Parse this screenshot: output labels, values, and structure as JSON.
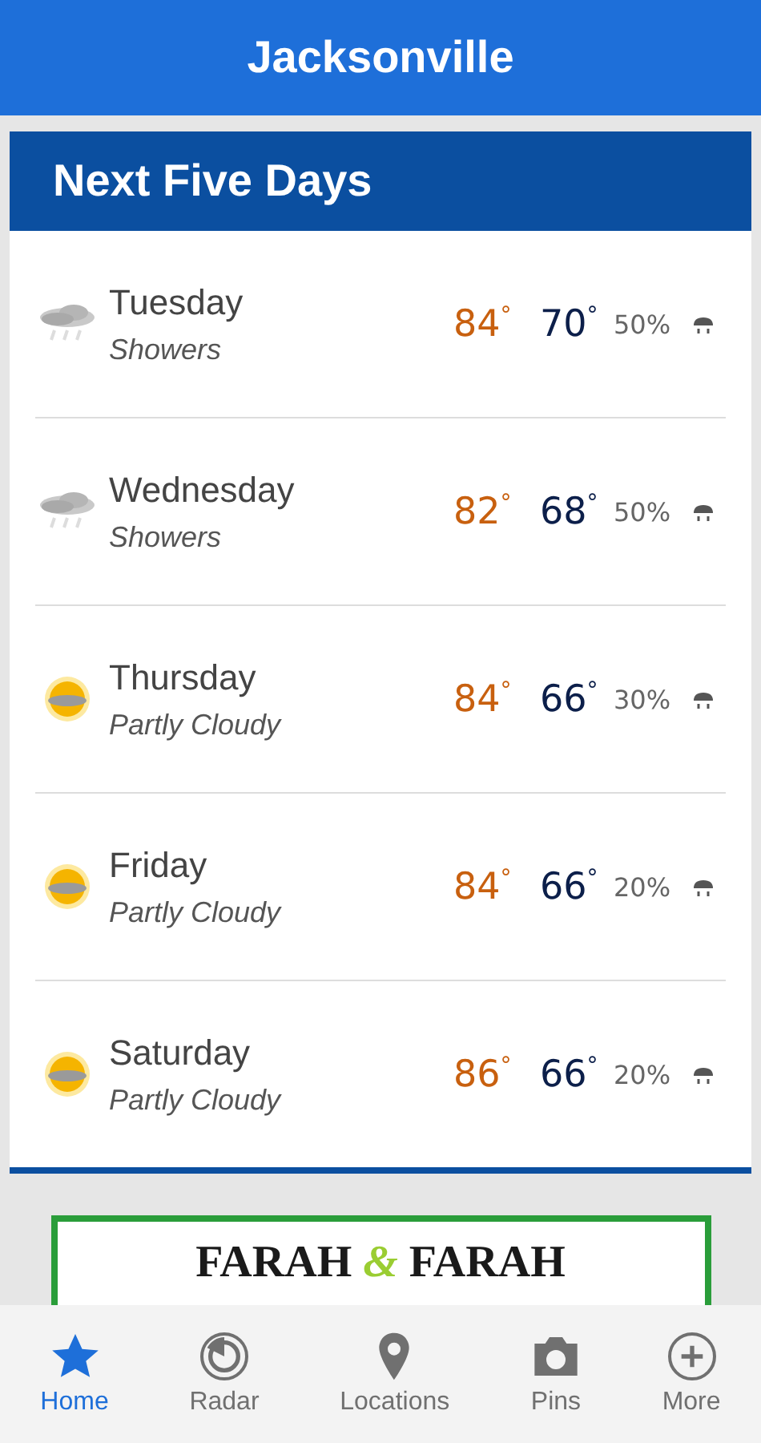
{
  "header": {
    "title": "Jacksonville"
  },
  "forecast": {
    "title": "Next Five Days",
    "days": [
      {
        "day": "Tuesday",
        "condition": "Showers",
        "kind": "showers",
        "high": "84",
        "low": "70",
        "precip": "50%"
      },
      {
        "day": "Wednesday",
        "condition": "Showers",
        "kind": "showers",
        "high": "82",
        "low": "68",
        "precip": "50%"
      },
      {
        "day": "Thursday",
        "condition": "Partly Cloudy",
        "kind": "partly-cloudy",
        "high": "84",
        "low": "66",
        "precip": "30%"
      },
      {
        "day": "Friday",
        "condition": "Partly Cloudy",
        "kind": "partly-cloudy",
        "high": "84",
        "low": "66",
        "precip": "20%"
      },
      {
        "day": "Saturday",
        "condition": "Partly Cloudy",
        "kind": "partly-cloudy",
        "high": "86",
        "low": "66",
        "precip": "20%"
      }
    ],
    "degree": "°"
  },
  "ad": {
    "left": "FARAH",
    "amp": "&",
    "right": "FARAH"
  },
  "tabs": [
    {
      "label": "Home",
      "kind": "home",
      "selected": true
    },
    {
      "label": "Radar",
      "kind": "radar",
      "selected": false
    },
    {
      "label": "Locations",
      "kind": "locations",
      "selected": false
    },
    {
      "label": "Pins",
      "kind": "pins",
      "selected": false
    },
    {
      "label": "More",
      "kind": "more",
      "selected": false
    }
  ]
}
